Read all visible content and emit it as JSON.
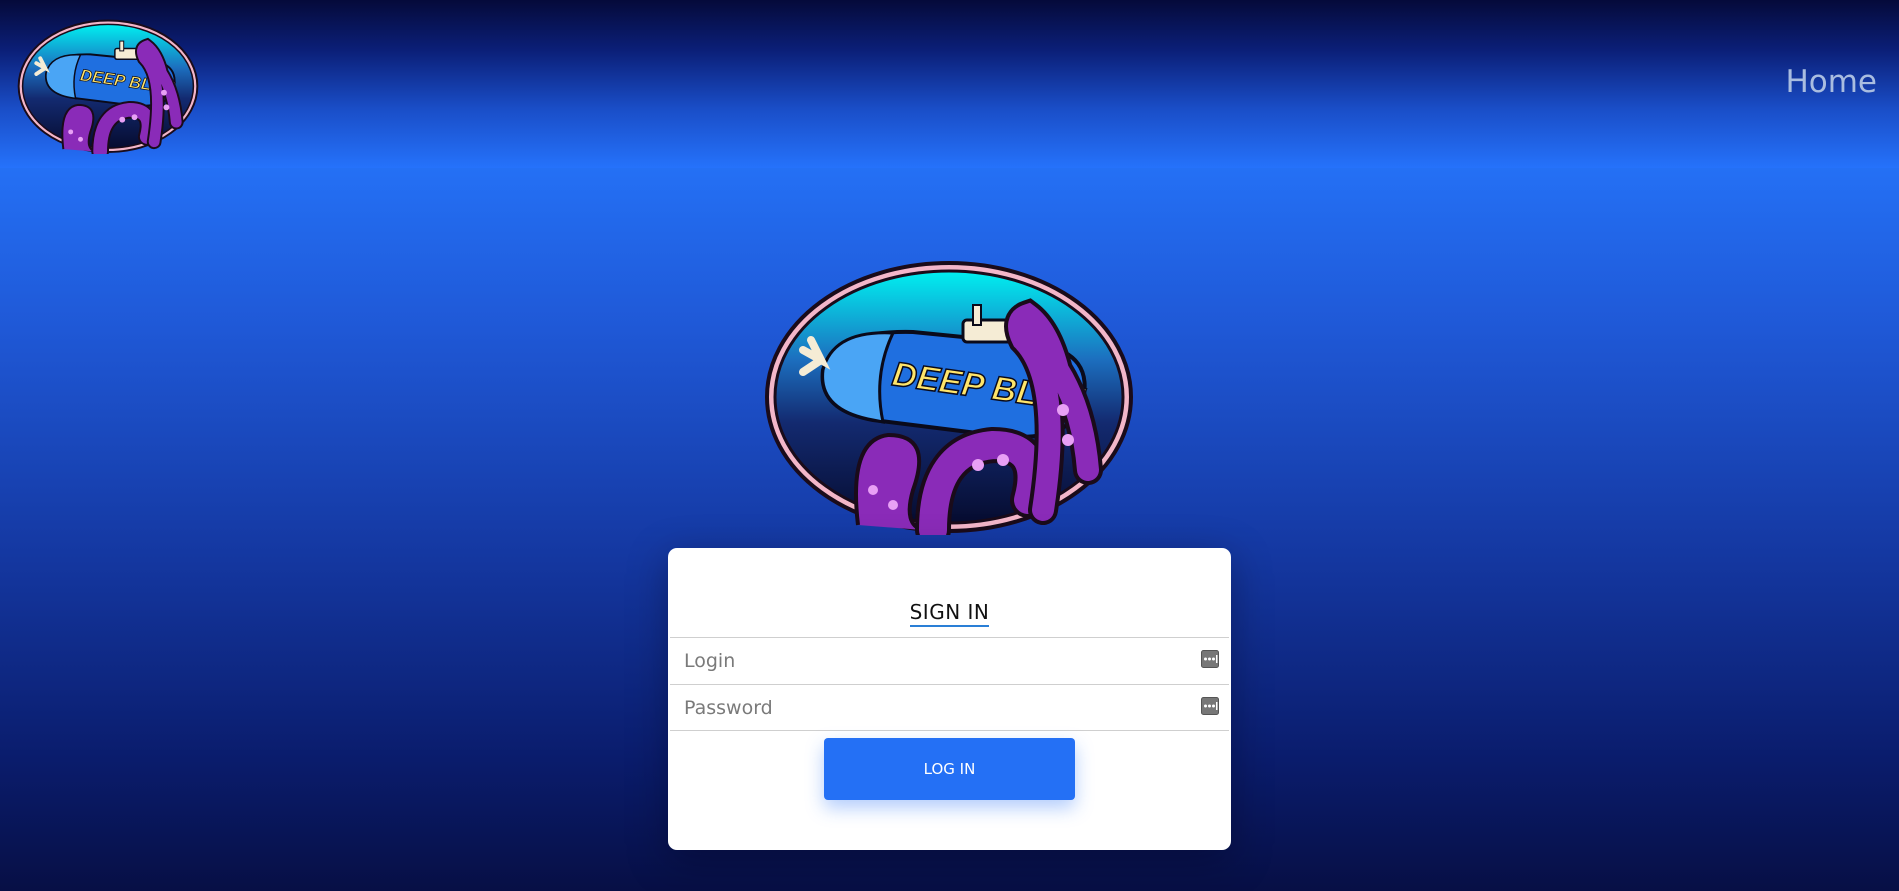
{
  "header": {
    "logo_icon": "deep-blue-submarine-logo",
    "logo_text": "DEEP BLUE",
    "nav_home": "Home"
  },
  "main": {
    "logo_icon": "deep-blue-submarine-logo",
    "logo_text": "DEEP BLUE"
  },
  "login_card": {
    "title": "SIGN IN",
    "login_placeholder": "Login",
    "password_placeholder": "Password",
    "field_icon": "password-manager-key-icon",
    "button_label": "LOG IN"
  },
  "colors": {
    "accent": "#2470f5",
    "header_top": "#050a3a",
    "nav_text": "#a9bde0",
    "title_underline": "#2a7fd6"
  }
}
